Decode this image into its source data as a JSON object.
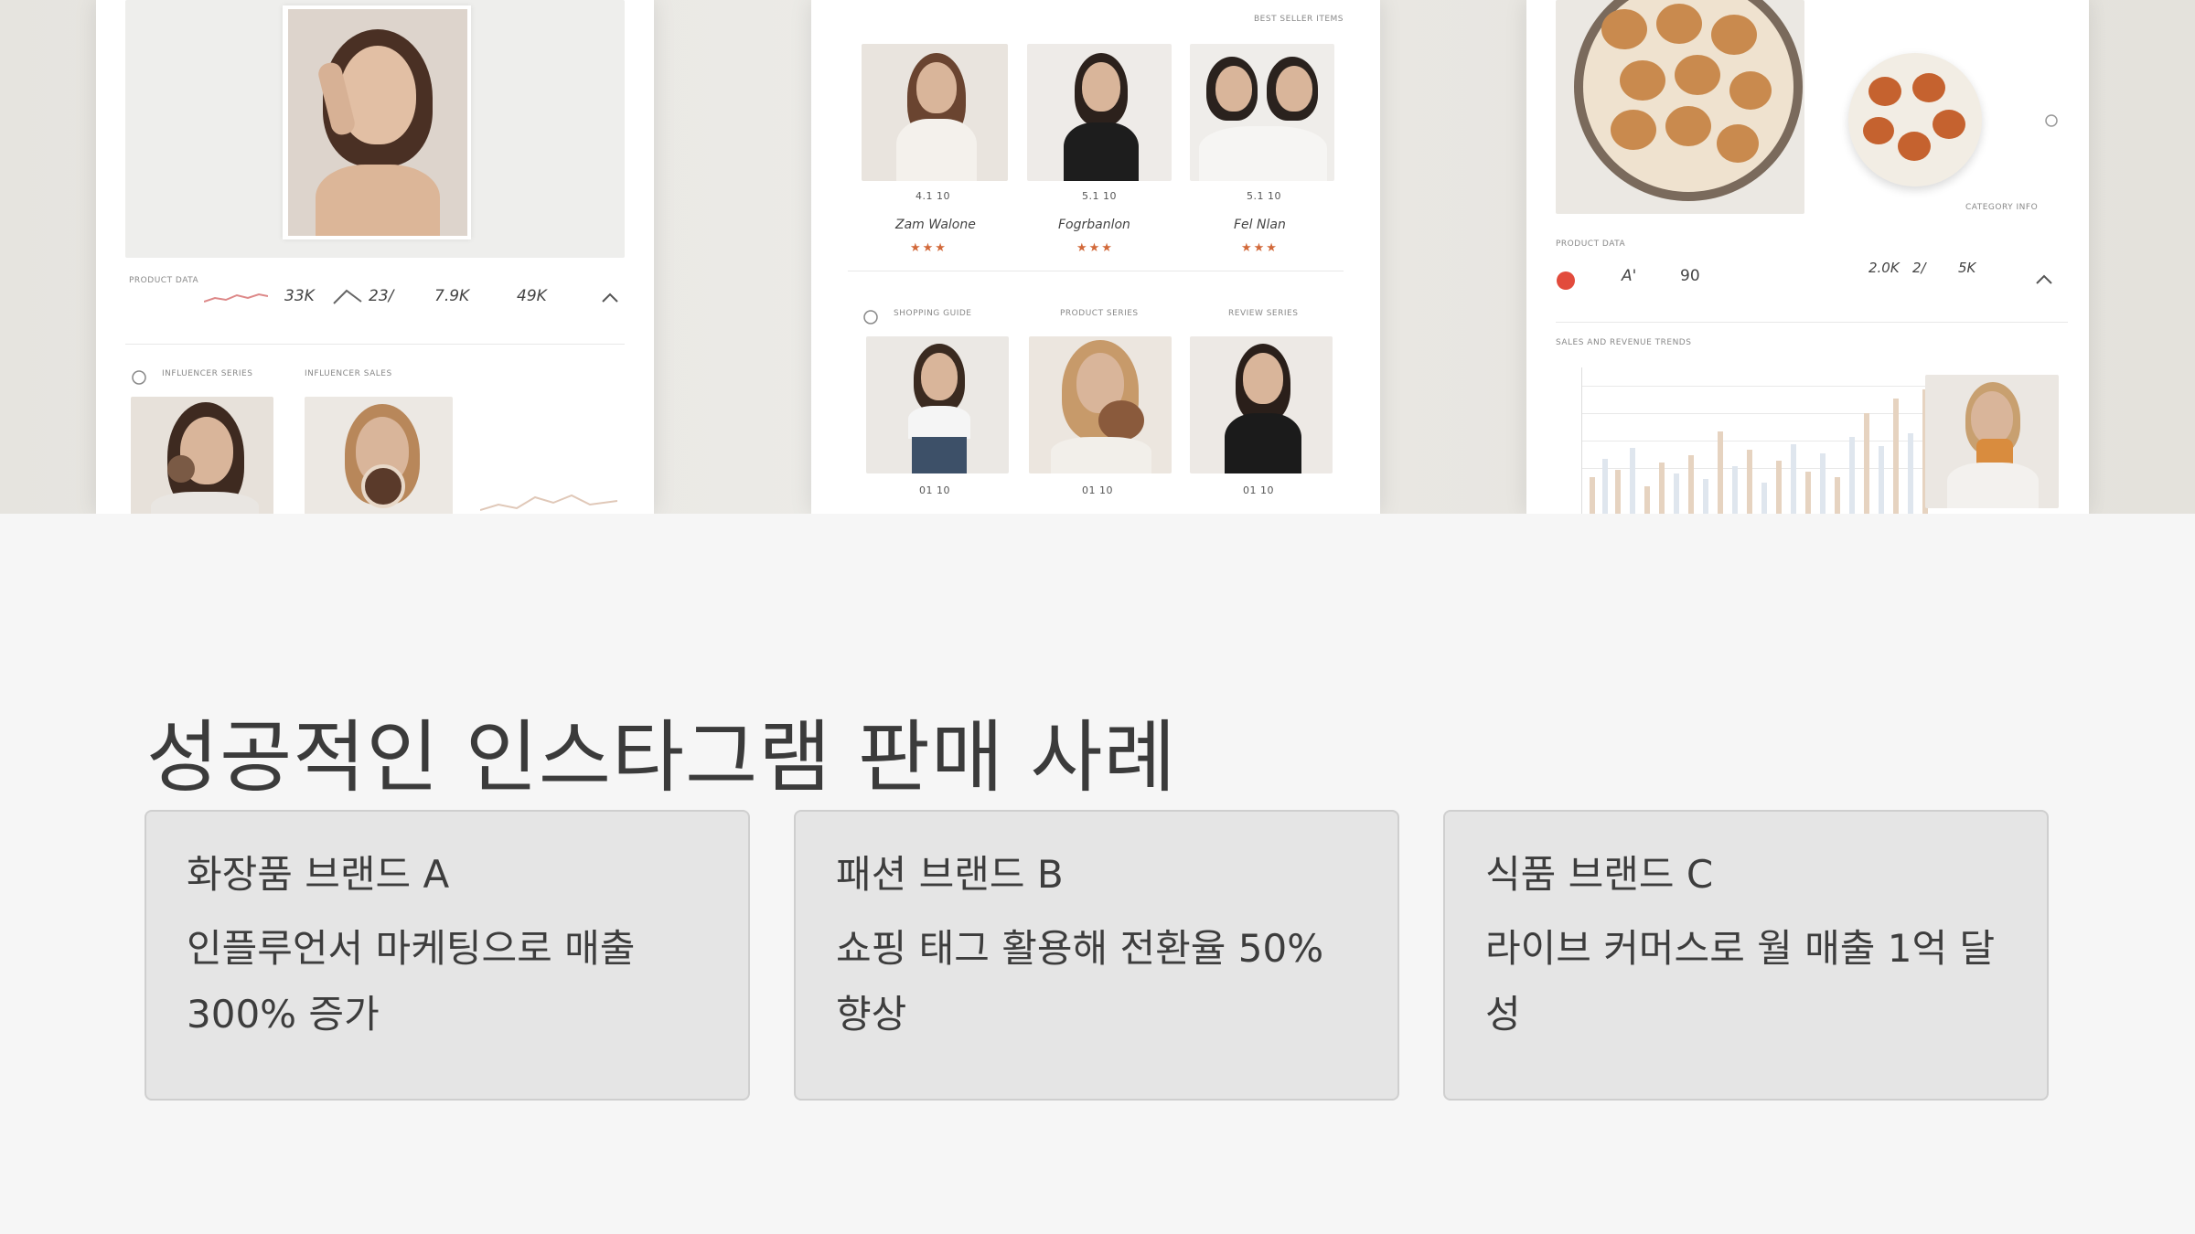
{
  "hero": {
    "mock1": {
      "stats": [
        "33K",
        "23/",
        "7.9K",
        "49K"
      ]
    },
    "mock2": {
      "prices_top": [
        "4.1 10",
        "5.1 10",
        "5.1 10"
      ],
      "names": [
        "Zam Walone",
        "Fogrbanlon",
        "Fel Nlan"
      ],
      "prices_bottom": [
        "01 10",
        "01 10",
        "01 10"
      ]
    },
    "mock3": {
      "stats": [
        "A'",
        "90",
        "2.0K",
        "2/",
        "5K"
      ]
    }
  },
  "title": "성공적인 인스타그램 판매 사례",
  "cards": [
    {
      "title": "화장품 브랜드 A",
      "body": "인플루언서 마케팅으로 매출 300% 증가"
    },
    {
      "title": "패션 브랜드 B",
      "body": "쇼핑 태그 활용해 전환율 50% 향상"
    },
    {
      "title": "식품 브랜드 C",
      "body": "라이브 커머스로 월 매출 1억 달성"
    }
  ]
}
